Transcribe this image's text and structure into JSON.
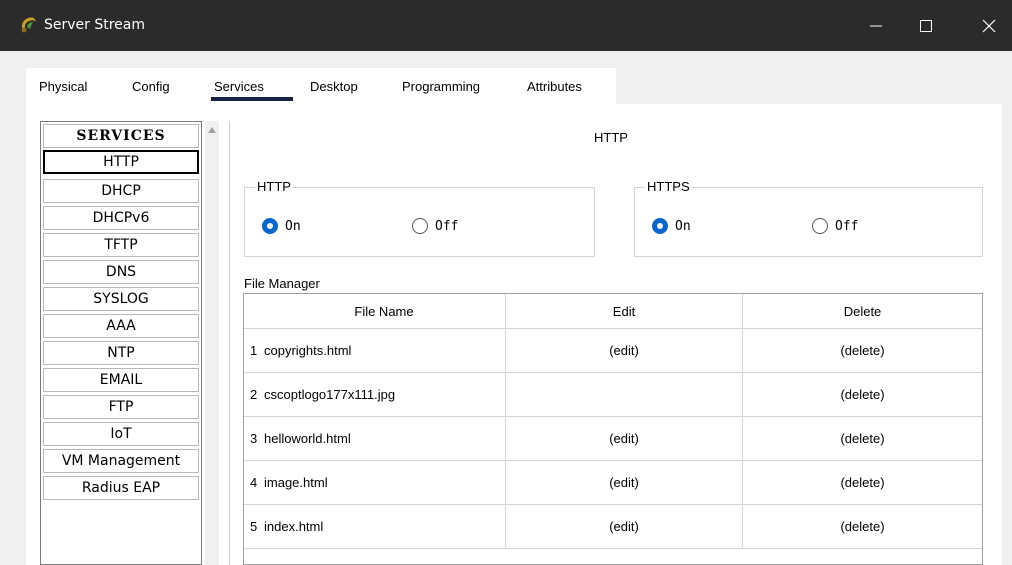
{
  "window": {
    "title": "Server Stream",
    "controls": [
      "minimize",
      "maximize",
      "close"
    ]
  },
  "tabs": [
    {
      "label": "Physical"
    },
    {
      "label": "Config"
    },
    {
      "label": "Services",
      "active": true
    },
    {
      "label": "Desktop"
    },
    {
      "label": "Programming"
    },
    {
      "label": "Attributes"
    }
  ],
  "services": {
    "header": "SERVICES",
    "items": [
      "HTTP",
      "DHCP",
      "DHCPv6",
      "TFTP",
      "DNS",
      "SYSLOG",
      "AAA",
      "NTP",
      "EMAIL",
      "FTP",
      "IoT",
      "VM Management",
      "Radius EAP"
    ],
    "selected": "HTTP"
  },
  "main": {
    "title": "HTTP",
    "http_group": {
      "legend": "HTTP",
      "on_label": "On",
      "off_label": "Off",
      "value": "On"
    },
    "https_group": {
      "legend": "HTTPS",
      "on_label": "On",
      "off_label": "Off",
      "value": "On"
    },
    "file_manager": {
      "label": "File Manager",
      "columns": [
        "File Name",
        "Edit",
        "Delete"
      ],
      "rows": [
        {
          "index": "1",
          "name": "copyrights.html",
          "edit": "(edit)",
          "delete": "(delete)"
        },
        {
          "index": "2",
          "name": "cscoptlogo177x111.jpg",
          "edit": "",
          "delete": "(delete)"
        },
        {
          "index": "3",
          "name": "helloworld.html",
          "edit": "(edit)",
          "delete": "(delete)"
        },
        {
          "index": "4",
          "name": "image.html",
          "edit": "(edit)",
          "delete": "(delete)"
        },
        {
          "index": "5",
          "name": "index.html",
          "edit": "(edit)",
          "delete": "(delete)"
        }
      ]
    }
  },
  "colors": {
    "titlebar": "#2b2b2b",
    "tab_underline": "#19233f",
    "radio_checked": "#0a66cc"
  }
}
